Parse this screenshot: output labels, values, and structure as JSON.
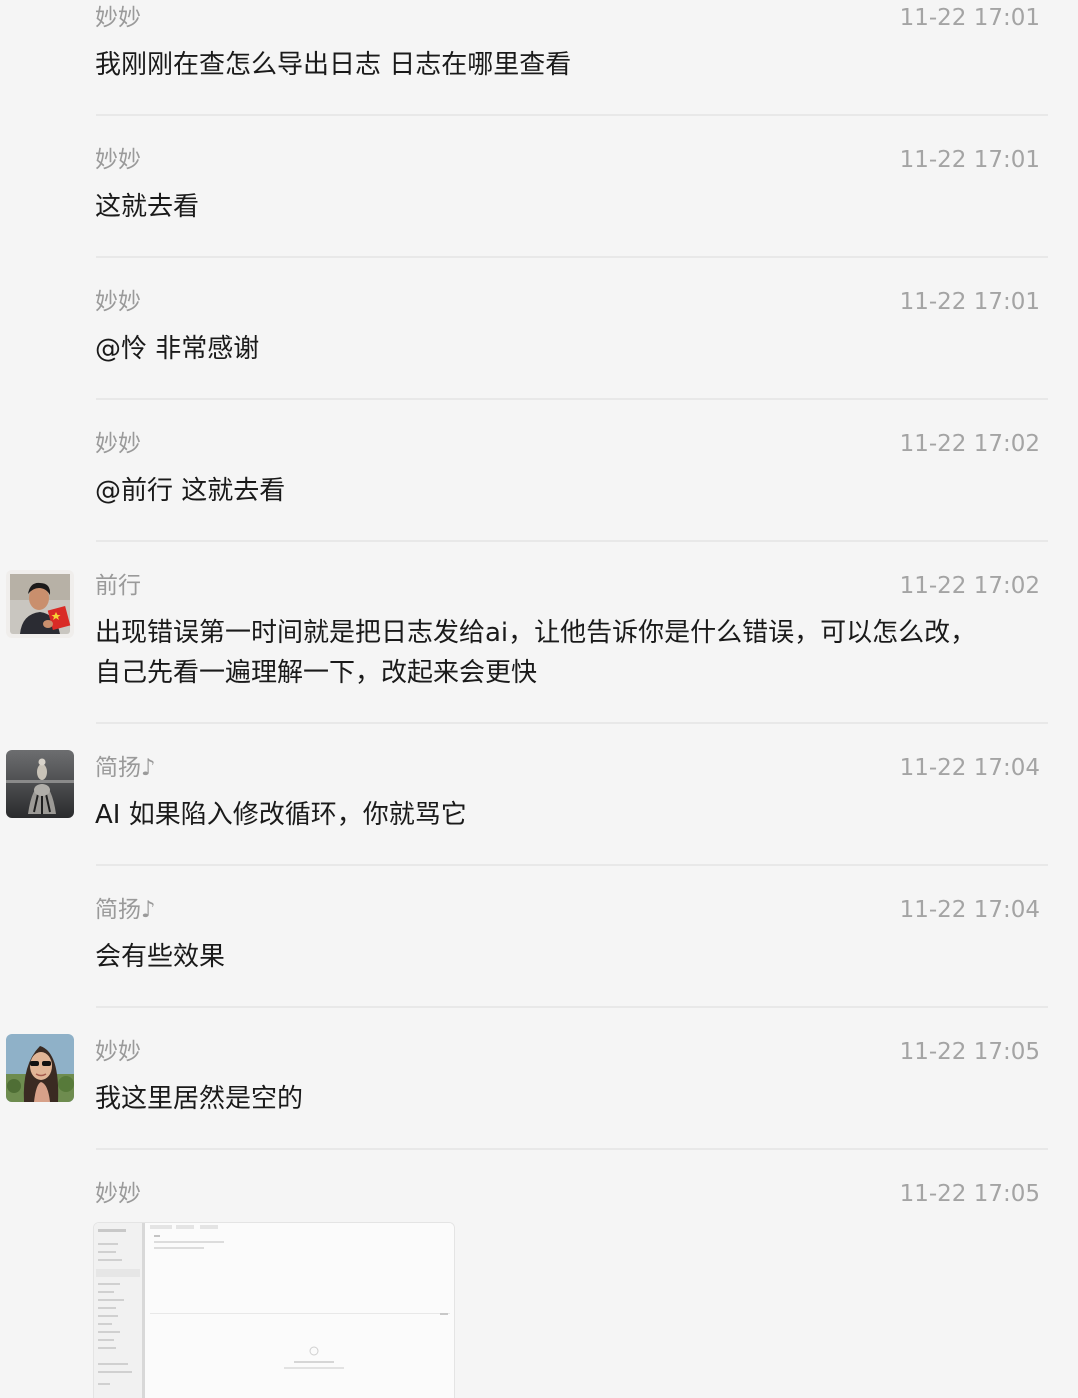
{
  "messages": [
    {
      "sender": "妙妙",
      "time": "11-22 17:01",
      "text": "我刚刚在查怎么导出日志 日志在哪里查看",
      "avatar": "none"
    },
    {
      "sender": "妙妙",
      "time": "11-22 17:01",
      "text": "这就去看",
      "avatar": "none"
    },
    {
      "sender": "妙妙",
      "time": "11-22 17:01",
      "text": "@怜 非常感谢",
      "avatar": "none"
    },
    {
      "sender": "妙妙",
      "time": "11-22 17:02",
      "text": "@前行 这就去看",
      "avatar": "none"
    },
    {
      "sender": "前行",
      "time": "11-22 17:02",
      "text_line1": "出现错误第一时间就是把日志发给ai，让他告诉你是什么错误，可以怎么改，",
      "text_line2": "自己先看一遍理解一下，改起来会更快",
      "avatar": "man-with-flag"
    },
    {
      "sender": "简扬♪",
      "time": "11-22 17:04",
      "text": "AI 如果陷入修改循环，你就骂它",
      "avatar": "tiger-reflection"
    },
    {
      "sender": "简扬♪",
      "time": "11-22 17:04",
      "text": "会有些效果",
      "avatar": "none"
    },
    {
      "sender": "妙妙",
      "time": "11-22 17:05",
      "text": "我这里居然是空的",
      "avatar": "woman-sunglasses"
    },
    {
      "sender": "妙妙",
      "time": "11-22 17:05",
      "attachment": "screenshot-image",
      "avatar": "none"
    }
  ],
  "colors": {
    "background": "#f5f5f5",
    "sender": "#9a9a9a",
    "time": "#a4a4a4",
    "text": "#1a1a1a",
    "divider": "#e8e8e8"
  }
}
